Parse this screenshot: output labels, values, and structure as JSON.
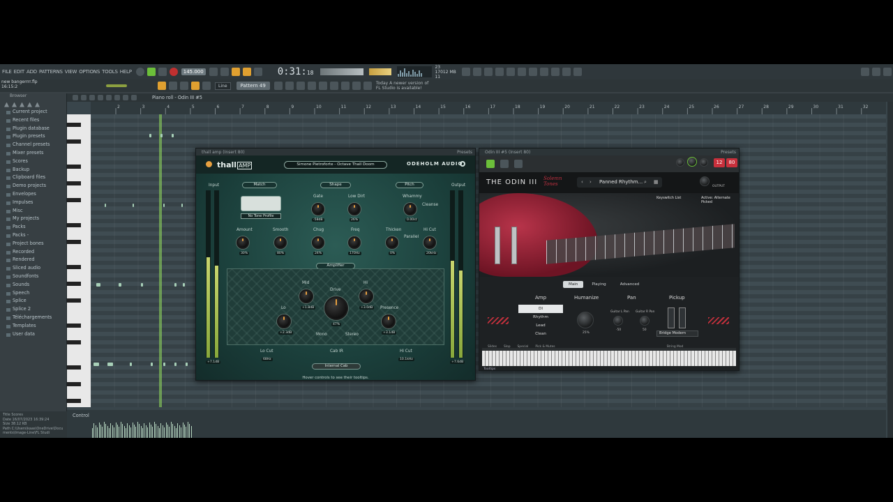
{
  "menu": [
    "FILE",
    "EDIT",
    "ADD",
    "PATTERNS",
    "VIEW",
    "OPTIONS",
    "TOOLS",
    "HELP"
  ],
  "tempo": "145.000",
  "time": {
    "main": "0:31",
    "sub": "18"
  },
  "perf": {
    "voices": "23",
    "ram": "17012 MB",
    "cpu_extra": "11"
  },
  "hint": {
    "file": "new bangerrrr.flp",
    "position": "16:15:2"
  },
  "pattern": "Pattern 49",
  "line_mode": "Line",
  "news": {
    "line1": "Today   A newer version of",
    "line2": "FL Studio is available!"
  },
  "browser": {
    "title": "Browser",
    "items": [
      "Current project",
      "Recent files",
      "Plugin database",
      "Plugin presets",
      "Channel presets",
      "Mixer presets",
      "Scores",
      "Backup",
      "Clipboard files",
      "Demo projects",
      "Envelopes",
      "Impulses",
      "Misc",
      "My projects",
      "Packs",
      "Packs -",
      "Project bones",
      "Recorded",
      "Rendered",
      "Sliced audio",
      "Soundfonts",
      "Sounds",
      "Speech",
      "Splice",
      "Splice 2",
      "Téléchargements",
      "Templates",
      "User data"
    ],
    "footer": {
      "title_label": "Title",
      "title_value": "Scores",
      "date_label": "Date",
      "date_value": "16/07/2023 16:39:24",
      "size_label": "Size",
      "size_value": "38.12 KB",
      "path_label": "Path",
      "path_value": "C:\\Users\\kaas\\OneDrive\\Documents\\Image-Line\\FL Studi"
    }
  },
  "piano_roll": {
    "title": "Piano roll - Odin III #5",
    "ruler": [
      "2",
      "3",
      "4",
      "5",
      "6",
      "7",
      "8",
      "9",
      "10",
      "11",
      "12",
      "13",
      "14",
      "15",
      "16",
      "17",
      "18",
      "19",
      "20",
      "21",
      "22",
      "23",
      "24",
      "25",
      "26",
      "27",
      "28",
      "29",
      "30",
      "31",
      "32"
    ],
    "control_label": "Control"
  },
  "thall": {
    "window_title": "thall amp (Insert 80)",
    "presets_label": "Presets",
    "logo": "thall",
    "logo_box": "AMP",
    "preset": "Simone Pietroforte - Octave Thall Doom",
    "brand": "ODEHOLM AUDIO",
    "input_label": "Input",
    "output_label": "Output",
    "input_value": "+7.1dB",
    "output_value": "+7.6dB",
    "sections": {
      "match": "Match",
      "shape": "Shape",
      "pitch": "Pitch",
      "amplifier": "Amplifier",
      "cab": "Cab IR"
    },
    "tone_profile": "No Tone Profile",
    "knobs": {
      "amount": {
        "label": "Amount",
        "value": "30%"
      },
      "smooth": {
        "label": "Smooth",
        "value": "80%"
      },
      "gate": {
        "label": "Gate",
        "value": "-58dB"
      },
      "lowdirt": {
        "label": "Low Dirt",
        "value": "26%"
      },
      "chug": {
        "label": "Chug",
        "value": "24%"
      },
      "freq": {
        "label": "Freq",
        "value": "170Hz"
      },
      "whammy": {
        "label": "Whammy",
        "value": "0.00st"
      },
      "thicken": {
        "label": "Thicken",
        "value": "0%"
      },
      "hicut": {
        "label": "Hi Cut",
        "value": "20kHz"
      },
      "mid": {
        "label": "Mid",
        "value": "+1.8dB"
      },
      "drive": {
        "label": "Drive",
        "value": "47%"
      },
      "hi": {
        "label": "Hi",
        "value": "+3.0dB"
      },
      "lo": {
        "label": "Lo",
        "value": "+2.3dB"
      },
      "presence": {
        "label": "Presence",
        "value": "+3.1dB"
      },
      "locut": {
        "label": "Lo Cut",
        "value": "68Hz"
      },
      "hicut2": {
        "label": "Hi Cut",
        "value": "10.1kHz"
      }
    },
    "cleanse": "Cleanse",
    "parallel": "Parallel",
    "mono": "Mono",
    "stereo": "Stereo",
    "cab_name": "Internal Cab",
    "tooltip_hint": "Hover controls to see their tooltips."
  },
  "odin": {
    "window_title": "Odin III #5 (Insert 80)",
    "presets_label": "Presets",
    "logo": "THE ODIN III",
    "solemn_line1": "Solemn",
    "solemn_line2": "Tones",
    "preset": "Panned Rhythm...",
    "output_label": "OUTPUT",
    "badge1": "12",
    "badge2": "80",
    "keyswitch": "Keyswitch List",
    "active": "Active:",
    "active_value": "Alternate Picked",
    "tabs": [
      "Main",
      "Playing",
      "Advanced"
    ],
    "amp_label": "Amp",
    "humanize_label": "Humanize",
    "humanize_value": "25%",
    "pan_label": "Pan",
    "pickup_label": "Pickup",
    "amp_items": [
      "DI",
      "Rhythm",
      "Lead",
      "Clean"
    ],
    "guitar_l": "Guitar L Pan",
    "guitar_r": "Guitar R Pan",
    "pan_l_val": "-50",
    "pan_r_val": "50",
    "pickup_value": "Bridge Modern",
    "key_labels": [
      "Slides",
      "Slop",
      "Special",
      "Pick & Mutes",
      "String Mod"
    ],
    "tooltips": "Tooltips"
  }
}
